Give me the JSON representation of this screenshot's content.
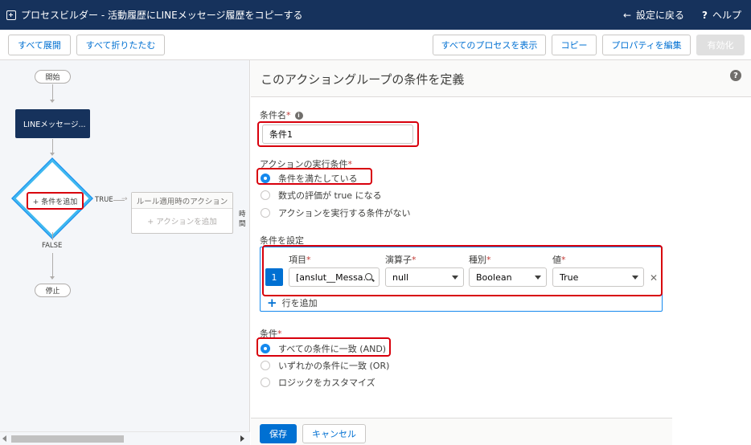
{
  "header": {
    "title": "プロセスビルダー - 活動履歴にLINEメッセージ履歴をコピーする",
    "back_label": "設定に戻る",
    "help_label": "ヘルプ"
  },
  "toolbar": {
    "expand_all": "すべて展開",
    "collapse_all": "すべて折りたたむ",
    "show_all_processes": "すべてのプロセスを表示",
    "copy": "コピー",
    "edit_properties": "プロパティを編集",
    "activate": "有効化"
  },
  "canvas": {
    "start": "開始",
    "node_label": "LINEメッセージ...",
    "add_condition": "+ 条件を追加",
    "true_label": "TRUE",
    "false_label": "FALSE",
    "rule_action_title": "ルール適用時のアクション",
    "add_action": "+ アクションを追加",
    "side_text": "時間",
    "stop": "停止"
  },
  "panel": {
    "title": "このアクショングループの条件を定義",
    "condition_name_label": "条件名",
    "condition_name_value": "条件1",
    "execution_label": "アクションの実行条件",
    "execution_options": [
      {
        "label": "条件を満たしている",
        "selected": true
      },
      {
        "label": "数式の評価が true になる",
        "selected": false
      },
      {
        "label": "アクションを実行する条件がない",
        "selected": false
      }
    ],
    "set_conditions_label": "条件を設定",
    "columns": {
      "field": "項目",
      "operator": "演算子",
      "type": "種別",
      "value": "値"
    },
    "rows": [
      {
        "num": "1",
        "field": "[anslut__Messa...",
        "operator": "null",
        "type": "Boolean",
        "value": "True"
      }
    ],
    "add_row": "行を追加",
    "conditions_label": "条件",
    "logic_options": [
      {
        "label": "すべての条件に一致 (AND)",
        "selected": true
      },
      {
        "label": "いずれかの条件に一致 (OR)",
        "selected": false
      },
      {
        "label": "ロジックをカスタマイズ",
        "selected": false
      }
    ],
    "save": "保存",
    "cancel": "キャンセル"
  }
}
